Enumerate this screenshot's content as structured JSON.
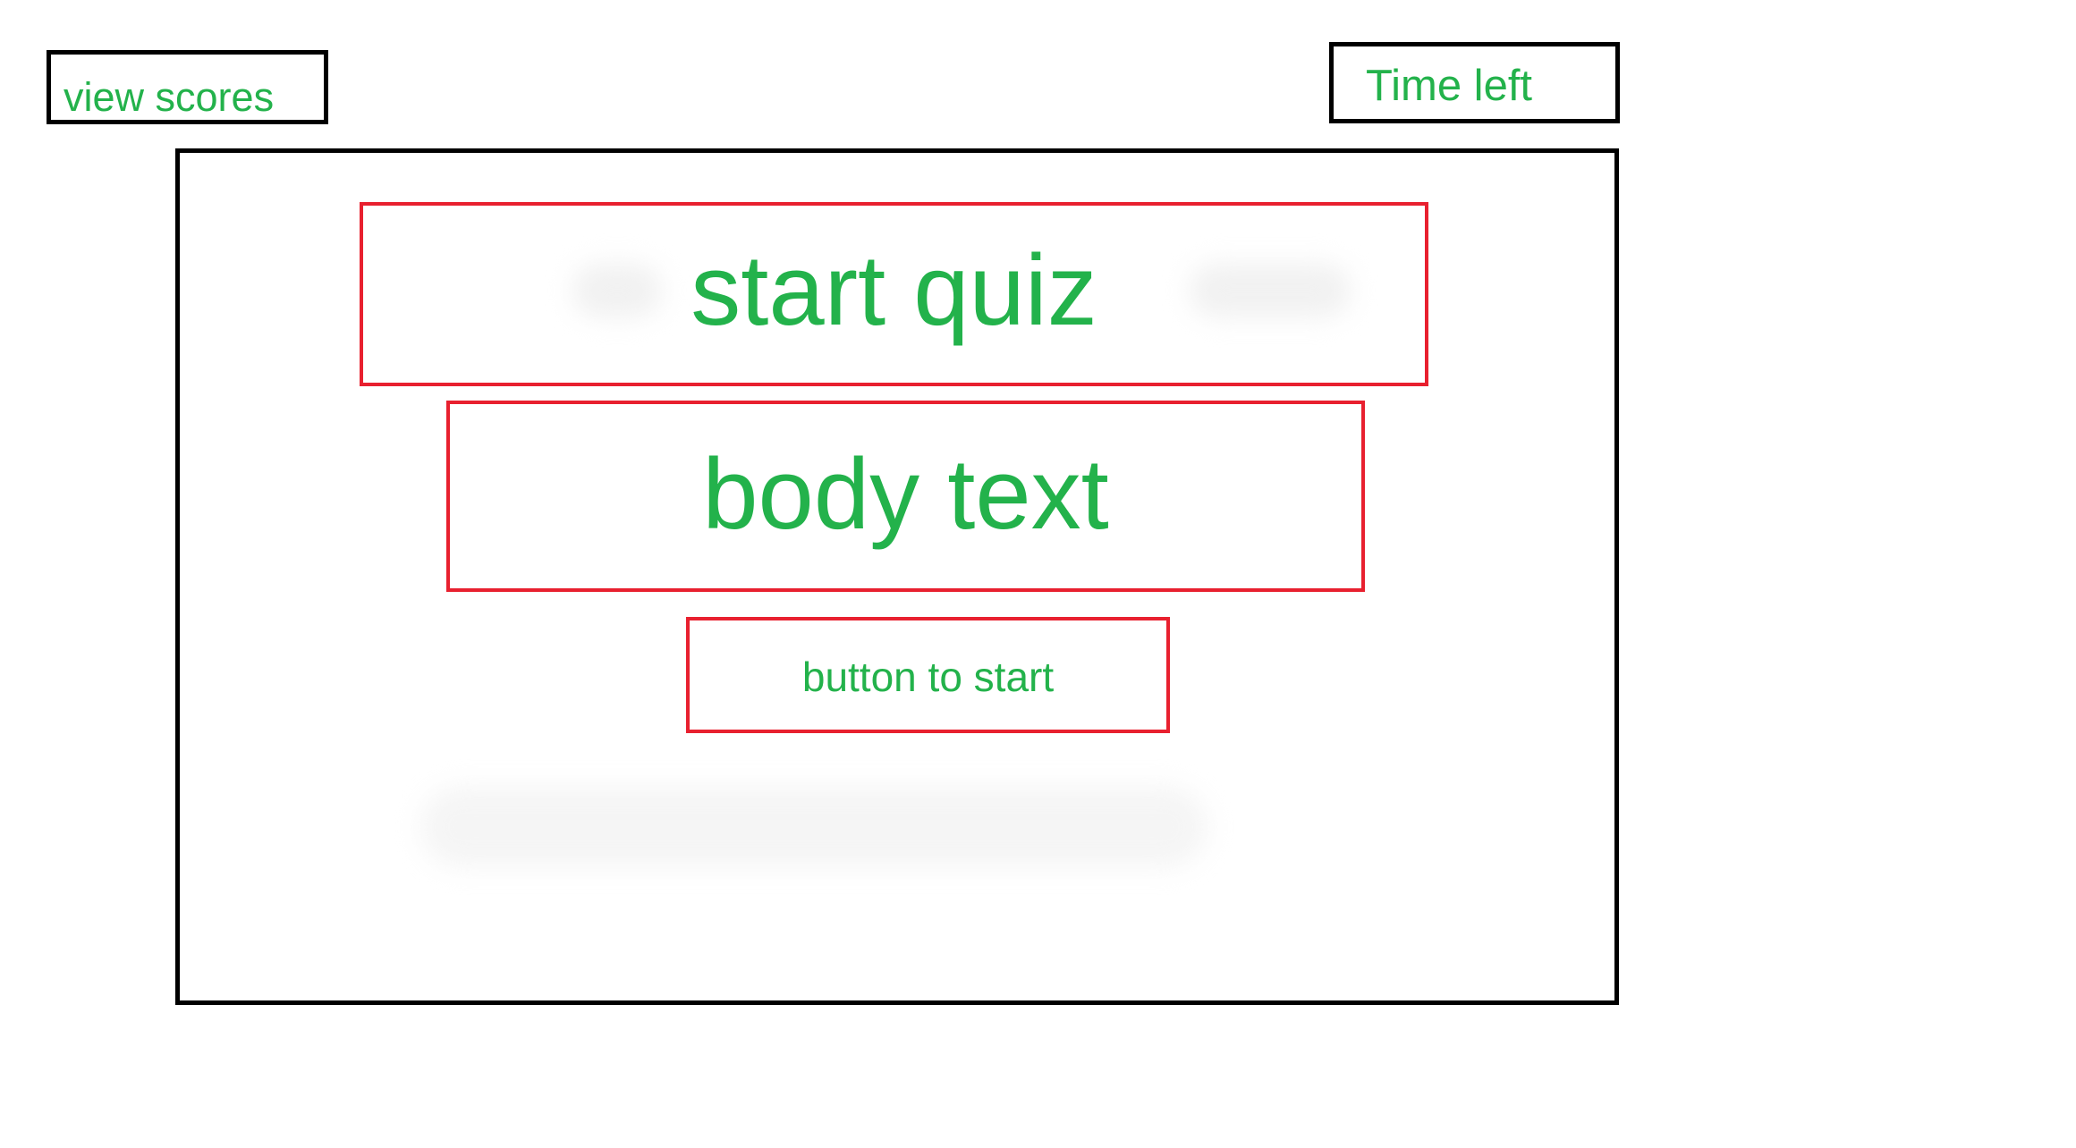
{
  "header": {
    "view_scores_label": "view scores",
    "time_left_label": "Time left"
  },
  "quiz": {
    "title": "start quiz",
    "body": "body text",
    "start_button_label": "button to start"
  },
  "colors": {
    "text": "#23b24b",
    "container_border": "#000000",
    "highlight_border": "#e8202f"
  }
}
